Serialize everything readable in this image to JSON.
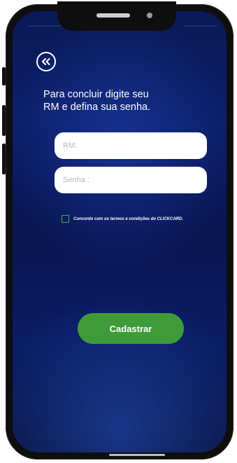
{
  "screen": {
    "back_icon": "double-chevron-left-icon",
    "instruction_line1": "Para concluir digite seu",
    "instruction_line2": "RM e defina sua senha.",
    "rm_placeholder": "RM:",
    "password_placeholder": "Senha :",
    "terms_label": "Concordo com os termos e condições do CLICKCARD.",
    "terms_checked": false,
    "submit_label": "Cadastrar"
  },
  "colors": {
    "background": "#0c1f6a",
    "button": "#3f9b3a",
    "checkbox_border": "#44a84a",
    "text": "#ffffff"
  }
}
